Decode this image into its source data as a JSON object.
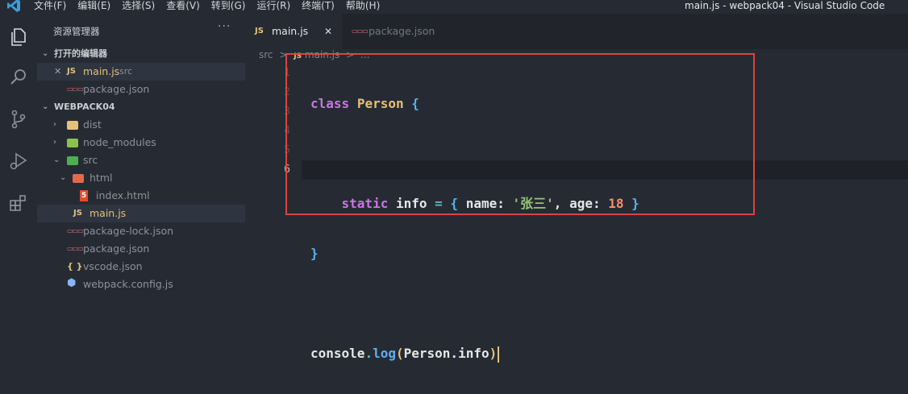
{
  "titlebar": {
    "menu": [
      "文件(F)",
      "编辑(E)",
      "选择(S)",
      "查看(V)",
      "转到(G)",
      "运行(R)",
      "终端(T)",
      "帮助(H)"
    ],
    "window_title": "main.js - webpack04 - Visual Studio Code"
  },
  "sidebar": {
    "title": "资源管理器",
    "more": "···",
    "open_editors_header": "打开的编辑器",
    "open_editors": [
      {
        "icon": "JS",
        "name": "main.js",
        "hint": "src",
        "close": "✕"
      },
      {
        "icon": "{}",
        "name": "package.json"
      }
    ],
    "project_header": "WEBPACK04",
    "tree": [
      {
        "name": "dist"
      },
      {
        "name": "node_modules"
      },
      {
        "name": "src"
      },
      {
        "name": "html"
      },
      {
        "name": "index.html"
      },
      {
        "name": "main.js",
        "icon": "JS"
      },
      {
        "name": "package-lock.json"
      },
      {
        "name": "package.json"
      },
      {
        "name": "vscode.json",
        "icon": "{ }"
      },
      {
        "name": "webpack.config.js"
      }
    ]
  },
  "tabs": [
    {
      "icon": "JS",
      "label": "main.js",
      "close": "✕"
    },
    {
      "label": "package.json"
    }
  ],
  "breadcrumb": {
    "folder": "src",
    "sep": ">",
    "icon": "JS",
    "file": "main.js",
    "more": "..."
  },
  "editor": {
    "line_numbers": [
      "1",
      "2",
      "3",
      "4",
      "5",
      "6"
    ],
    "lines": [
      "class Person {",
      "",
      "    static info = { name: '张三', age: 18 }",
      "}",
      "",
      "console.log(Person.info)"
    ],
    "tokens": {
      "class": "class",
      "Person": "Person",
      "brace_open": "{",
      "brace_close": "}",
      "static": "static",
      "info": "info",
      "eq": "=",
      "name": "name",
      "colon": ":",
      "str": "'张三'",
      "comma": ",",
      "age": "age",
      "num": "18",
      "console": "console",
      "dot": ".",
      "log": "log",
      "lp": "(",
      "rp": ")"
    }
  },
  "colors": {
    "highlight_box": "#e04242",
    "accent": "#e5c07b"
  }
}
